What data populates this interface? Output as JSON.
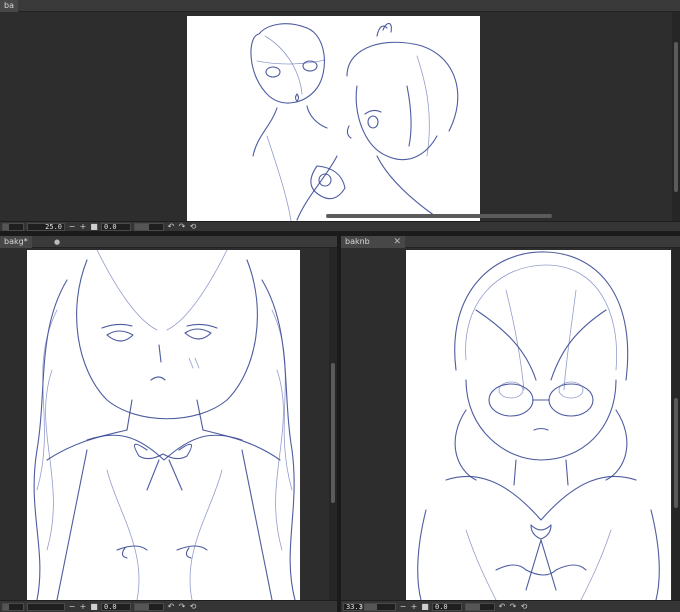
{
  "top_pane": {
    "tab_title": "ba",
    "status": {
      "zoom": "25.0",
      "angle": "0.0"
    }
  },
  "left_pane": {
    "tab_title": "bakg*",
    "tab_modified_marker": "●",
    "status": {
      "zoom": "",
      "angle": "0.0"
    }
  },
  "right_pane": {
    "tab_title": "baknb",
    "tab_close": "✕",
    "status": {
      "zoom": "33.3",
      "angle": "0.0"
    }
  },
  "icons": {
    "zoom_out": "−",
    "zoom_in": "+",
    "stop": "■",
    "rotate_left": "↶",
    "rotate_right": "↷",
    "reset": "⟲"
  }
}
